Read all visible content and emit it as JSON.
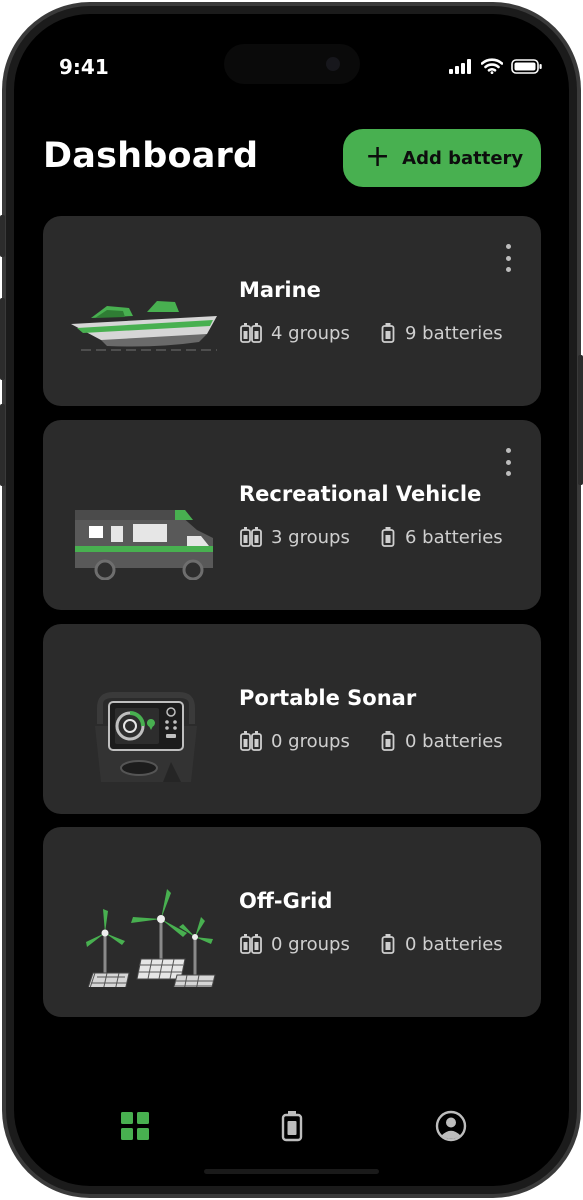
{
  "status_bar": {
    "time": "9:41"
  },
  "header": {
    "title": "Dashboard",
    "add_button_label": "Add battery"
  },
  "cards": [
    {
      "name": "Marine",
      "groups": "4 groups",
      "batteries": "9 batteries",
      "icon": "boat-illustration",
      "has_menu": true
    },
    {
      "name": "Recreational Vehicle",
      "groups": "3 groups",
      "batteries": "6 batteries",
      "icon": "rv-illustration",
      "has_menu": true
    },
    {
      "name": "Portable Sonar",
      "groups": "0 groups",
      "batteries": "0 batteries",
      "icon": "sonar-illustration",
      "has_menu": false
    },
    {
      "name": "Off-Grid",
      "groups": "0 groups",
      "batteries": "0 batteries",
      "icon": "offgrid-illustration",
      "has_menu": false
    }
  ],
  "tabbar": {
    "tabs": [
      {
        "icon": "grid-icon",
        "active": true
      },
      {
        "icon": "battery-icon",
        "active": false
      },
      {
        "icon": "profile-icon",
        "active": false
      }
    ]
  },
  "colors": {
    "accent": "#48b050",
    "card_bg": "#2b2b2b",
    "screen_bg": "#000000",
    "text_secondary": "#cfcfcf"
  }
}
